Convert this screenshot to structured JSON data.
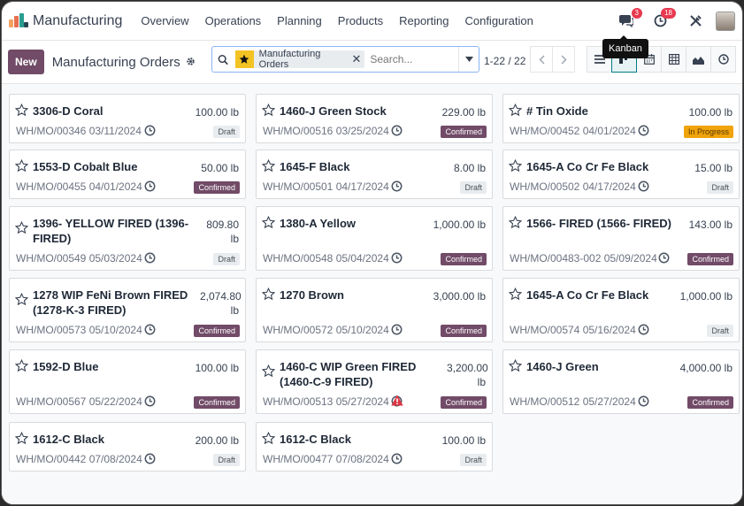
{
  "app": {
    "name": "Manufacturing",
    "menu": [
      "Overview",
      "Operations",
      "Planning",
      "Products",
      "Reporting",
      "Configuration"
    ],
    "chat_count": "3",
    "activity_count": "18"
  },
  "control": {
    "new_label": "New",
    "title": "Manufacturing Orders",
    "facet": "Manufacturing Orders",
    "search_placeholder": "Search...",
    "pager": "1-22 / 22",
    "tooltip": "Kanban"
  },
  "colors": {
    "brand": "#714b67",
    "accent": "#017e84",
    "in_progress": "#f0a30a"
  },
  "cards": [
    {
      "title": "3306-D Coral",
      "qty": "100.00 lb",
      "ref": "WH/MO/00346 03/11/2024",
      "status": "Draft"
    },
    {
      "title": "1460-J Green Stock",
      "qty": "229.00 lb",
      "ref": "WH/MO/00516 03/25/2024",
      "status": "Confirmed"
    },
    {
      "title": "# Tin Oxide",
      "qty": "100.00 lb",
      "ref": "WH/MO/00452 04/01/2024",
      "status": "In Progress"
    },
    {
      "title": "1553-D Cobalt Blue",
      "qty": "50.00 lb",
      "ref": "WH/MO/00455 04/01/2024",
      "status": "Confirmed"
    },
    {
      "title": "1645-F Black",
      "qty": "8.00 lb",
      "ref": "WH/MO/00501 04/17/2024",
      "status": "Draft"
    },
    {
      "title": "1645-A Co Cr Fe Black",
      "qty": "15.00 lb",
      "ref": "WH/MO/00502 04/17/2024",
      "status": "Draft"
    },
    {
      "title": "1396- YELLOW FIRED (1396-FIRED)",
      "qty": "809.80 lb",
      "ref": "WH/MO/00549 05/03/2024",
      "status": "Draft"
    },
    {
      "title": "1380-A Yellow",
      "qty": "1,000.00 lb",
      "ref": "WH/MO/00548 05/04/2024",
      "status": "Confirmed"
    },
    {
      "title": "1566- FIRED (1566- FIRED)",
      "qty": "143.00 lb",
      "ref": "WH/MO/00483-002 05/09/2024",
      "status": "Confirmed"
    },
    {
      "title": "1278 WIP FeNi Brown FIRED (1278-K-3 FIRED)",
      "qty": "2,074.80 lb",
      "ref": "WH/MO/00573 05/10/2024",
      "status": "Confirmed"
    },
    {
      "title": "1270 Brown",
      "qty": "3,000.00 lb",
      "ref": "WH/MO/00572 05/10/2024",
      "status": "Confirmed"
    },
    {
      "title": "1645-A Co Cr Fe Black",
      "qty": "1,000.00 lb",
      "ref": "WH/MO/00574 05/16/2024",
      "status": "Draft"
    },
    {
      "title": "1592-D Blue",
      "qty": "100.00 lb",
      "ref": "WH/MO/00567 05/22/2024",
      "status": "Confirmed"
    },
    {
      "title": "1460-C WIP Green FIRED (1460-C-9 FIRED)",
      "qty": "3,200.00 lb",
      "ref": "WH/MO/00513 05/27/2024",
      "status": "Confirmed",
      "warning": true
    },
    {
      "title": "1460-J Green",
      "qty": "4,000.00 lb",
      "ref": "WH/MO/00512 05/27/2024",
      "status": "Confirmed"
    },
    {
      "title": "1612-C Black",
      "qty": "200.00 lb",
      "ref": "WH/MO/00442 07/08/2024",
      "status": "Draft"
    },
    {
      "title": "1612-C Black",
      "qty": "100.00 lb",
      "ref": "WH/MO/00477 07/08/2024",
      "status": "Draft"
    }
  ]
}
